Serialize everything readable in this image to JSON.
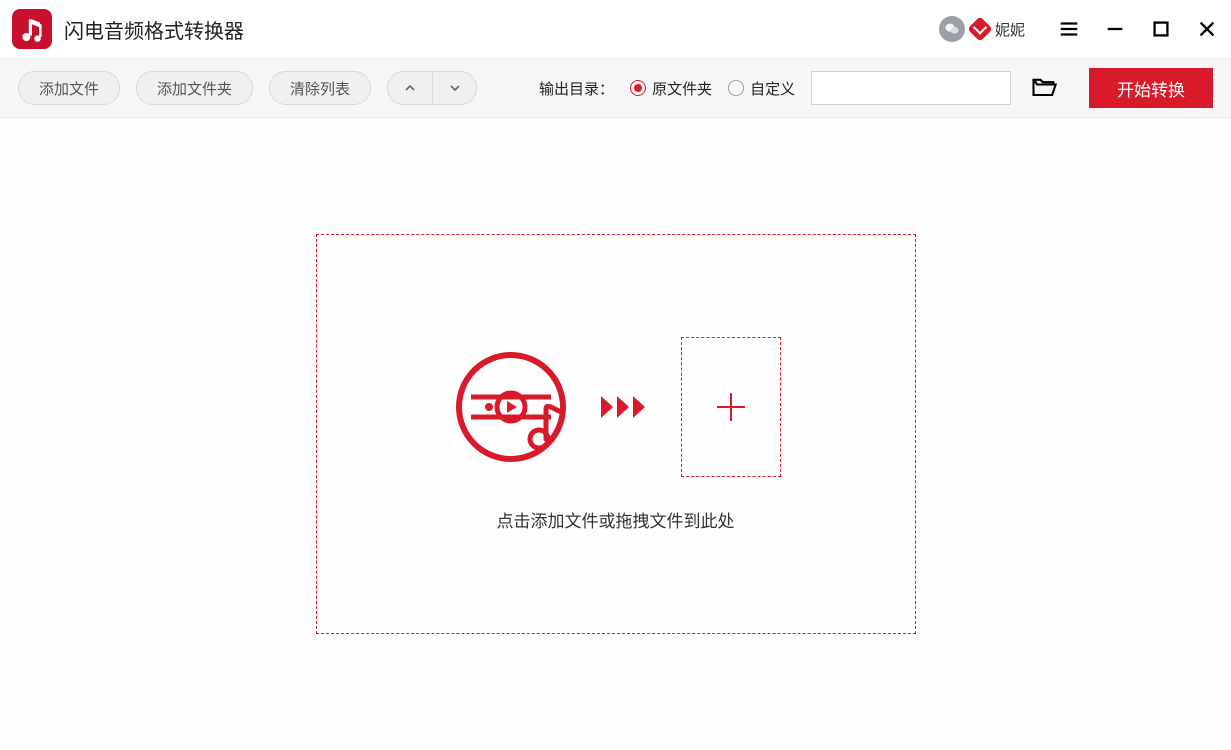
{
  "app": {
    "title": "闪电音频格式转换器"
  },
  "user": {
    "name": "妮妮"
  },
  "toolbar": {
    "add_file": "添加文件",
    "add_folder": "添加文件夹",
    "clear_list": "清除列表",
    "output_dir_label": "输出目录：",
    "radio_original": "原文件夹",
    "radio_custom": "自定义",
    "path_value": "",
    "start": "开始转换"
  },
  "dropzone": {
    "hint": "点击添加文件或拖拽文件到此处"
  }
}
